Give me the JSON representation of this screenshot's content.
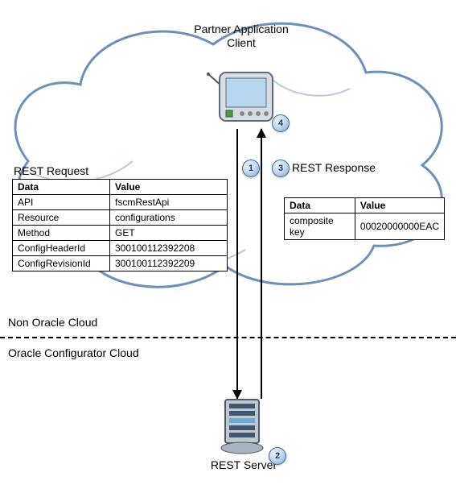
{
  "labels": {
    "client_title": "Partner Application\nClient",
    "server_title": "REST Server",
    "region_top": "Non Oracle Cloud",
    "region_bottom": "Oracle Configurator Cloud",
    "request_title": "REST Request",
    "response_title": "REST Response"
  },
  "steps": {
    "s1": "1",
    "s2": "2",
    "s3": "3",
    "s4": "4"
  },
  "request_table": {
    "headers": {
      "h1": "Data",
      "h2": "Value"
    },
    "rows": [
      {
        "d": "API",
        "v": "fscmRestApi"
      },
      {
        "d": "Resource",
        "v": "configurations"
      },
      {
        "d": "Method",
        "v": "GET"
      },
      {
        "d": "ConfigHeaderId",
        "v": "300100112392208"
      },
      {
        "d": "ConfigRevisionId",
        "v": "300100112392209"
      }
    ]
  },
  "response_table": {
    "headers": {
      "h1": "Data",
      "h2": "Value"
    },
    "rows": [
      {
        "d": "composite key",
        "v": "00020000000EAC"
      }
    ]
  }
}
